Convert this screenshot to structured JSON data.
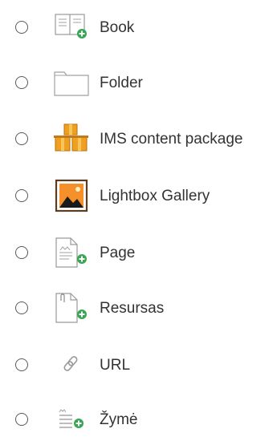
{
  "colors": {
    "text": "#333333",
    "radio_border": "#5a5a5a",
    "accent_green": "#3aa655",
    "box_orange": "#f0a020",
    "gallery_frame": "#5c3b1e",
    "gallery_sky": "#f5902a",
    "icon_gray": "#9a9a9a"
  },
  "activities": [
    {
      "label": "Book",
      "icon": "book-icon"
    },
    {
      "label": "Folder",
      "icon": "folder-icon"
    },
    {
      "label": "IMS content package",
      "icon": "ims-package-icon"
    },
    {
      "label": "Lightbox Gallery",
      "icon": "gallery-icon"
    },
    {
      "label": "Page",
      "icon": "page-icon"
    },
    {
      "label": "Resursas",
      "icon": "resource-icon"
    },
    {
      "label": "URL",
      "icon": "link-icon"
    },
    {
      "label": "Žymė",
      "icon": "label-icon"
    }
  ]
}
